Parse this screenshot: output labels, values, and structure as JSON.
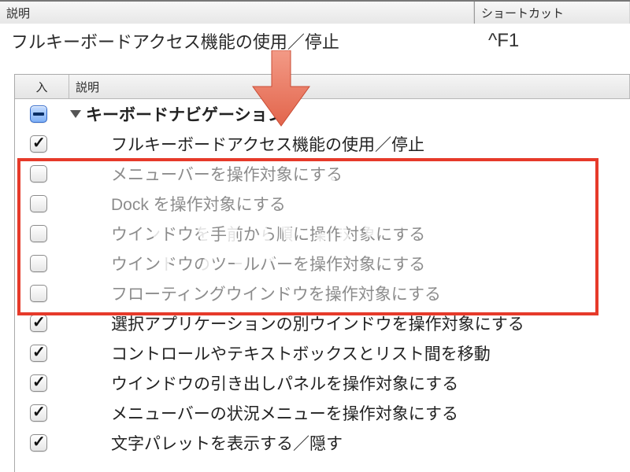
{
  "outer": {
    "header_desc": "説明",
    "header_shortcut": "ショートカット",
    "row_desc": "フルキーボードアクセス機能の使用／停止",
    "row_shortcut": "^F1"
  },
  "inner": {
    "header_on": "入",
    "header_desc": "説明",
    "group_label": "キーボードナビゲーション",
    "group_state": "mixed",
    "items": [
      {
        "label": "フルキーボードアクセス機能の使用／停止",
        "checked": true,
        "dim": false
      },
      {
        "label": "メニューバーを操作対象にする",
        "checked": false,
        "dim": true
      },
      {
        "label": "Dock を操作対象にする",
        "checked": false,
        "dim": true
      },
      {
        "label": "ウインドウを手前から順に操作対象にする",
        "checked": false,
        "dim": true
      },
      {
        "label": "ウインドウのツールバーを操作対象にする",
        "checked": false,
        "dim": true
      },
      {
        "label": "フローティングウインドウを操作対象にする",
        "checked": false,
        "dim": true
      },
      {
        "label": "選択アプリケーションの別ウインドウを操作対象にする",
        "checked": true,
        "dim": false
      },
      {
        "label": "コントロールやテキストボックスとリスト間を移動",
        "checked": true,
        "dim": false
      },
      {
        "label": "ウインドウの引き出しパネルを操作対象にする",
        "checked": true,
        "dim": false
      },
      {
        "label": "メニューバーの状況メニューを操作対象にする",
        "checked": true,
        "dim": false
      },
      {
        "label": "文字パレットを表示する／隠す",
        "checked": true,
        "dim": false
      }
    ]
  },
  "highlight": {
    "first_item_index": 1,
    "last_item_index": 5
  },
  "watermark_text": "Unclick"
}
